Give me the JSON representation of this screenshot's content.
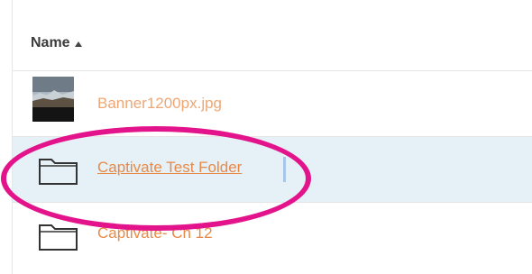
{
  "header": {
    "name_label": "Name",
    "sort_icon": "sort-ascending-icon"
  },
  "files": [
    {
      "name": "Banner1200px.jpg",
      "type": "image",
      "icon": "image-thumbnail",
      "selected": false
    },
    {
      "name": "Captivate Test Folder",
      "type": "folder",
      "icon": "folder-icon",
      "selected": true
    },
    {
      "name": "Captivate- Ch 12",
      "type": "folder",
      "icon": "folder-icon",
      "selected": false
    }
  ],
  "colors": {
    "link": "#e88a47",
    "selected_row": "#e6f0f7",
    "annotation_ring": "#e3148b"
  }
}
